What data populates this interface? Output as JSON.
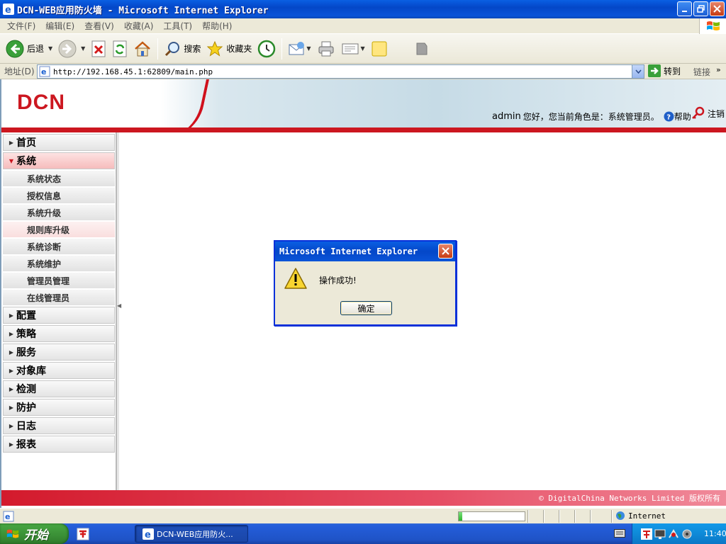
{
  "window": {
    "title": "DCN-WEB应用防火墙 - Microsoft Internet Explorer"
  },
  "menubar": {
    "items": [
      "文件(F)",
      "编辑(E)",
      "查看(V)",
      "收藏(A)",
      "工具(T)",
      "帮助(H)"
    ]
  },
  "toolbar": {
    "back_label": "后退",
    "search_label": "搜索",
    "favorites_label": "收藏夹"
  },
  "addressbar": {
    "label": "地址(D)",
    "url": "http://192.168.45.1:62809/main.php",
    "go_label": "转到",
    "links_label": "链接"
  },
  "page": {
    "logo": "DCN",
    "user": "admin",
    "greeting": "您好，您当前角色是：系统管理员。",
    "help_label": "帮助",
    "logout_label": "注销",
    "footer": "© DigitalChina Networks Limited 版权所有"
  },
  "sidebar": {
    "sections": [
      {
        "label": "首页",
        "expanded": false
      },
      {
        "label": "系统",
        "expanded": true,
        "children": [
          "系统状态",
          "授权信息",
          "系统升级",
          "规则库升级",
          "系统诊断",
          "系统维护",
          "管理员管理",
          "在线管理员"
        ],
        "highlighted_child": "规则库升级"
      },
      {
        "label": "配置",
        "expanded": false
      },
      {
        "label": "策略",
        "expanded": false
      },
      {
        "label": "服务",
        "expanded": false
      },
      {
        "label": "对象库",
        "expanded": false
      },
      {
        "label": "检测",
        "expanded": false
      },
      {
        "label": "防护",
        "expanded": false
      },
      {
        "label": "日志",
        "expanded": false
      },
      {
        "label": "报表",
        "expanded": false
      }
    ]
  },
  "dialog": {
    "title": "Microsoft Internet Explorer",
    "message": "操作成功!",
    "ok_label": "确定",
    "icon": "warning-icon"
  },
  "statusbar": {
    "zone_label": "Internet",
    "progress": 0.05
  },
  "taskbar": {
    "start_label": "开始",
    "task_label": "DCN-WEB应用防火...",
    "clock": "11:40"
  },
  "colors": {
    "brand_red": "#cc1720",
    "xp_blue": "#0a5fe3"
  }
}
